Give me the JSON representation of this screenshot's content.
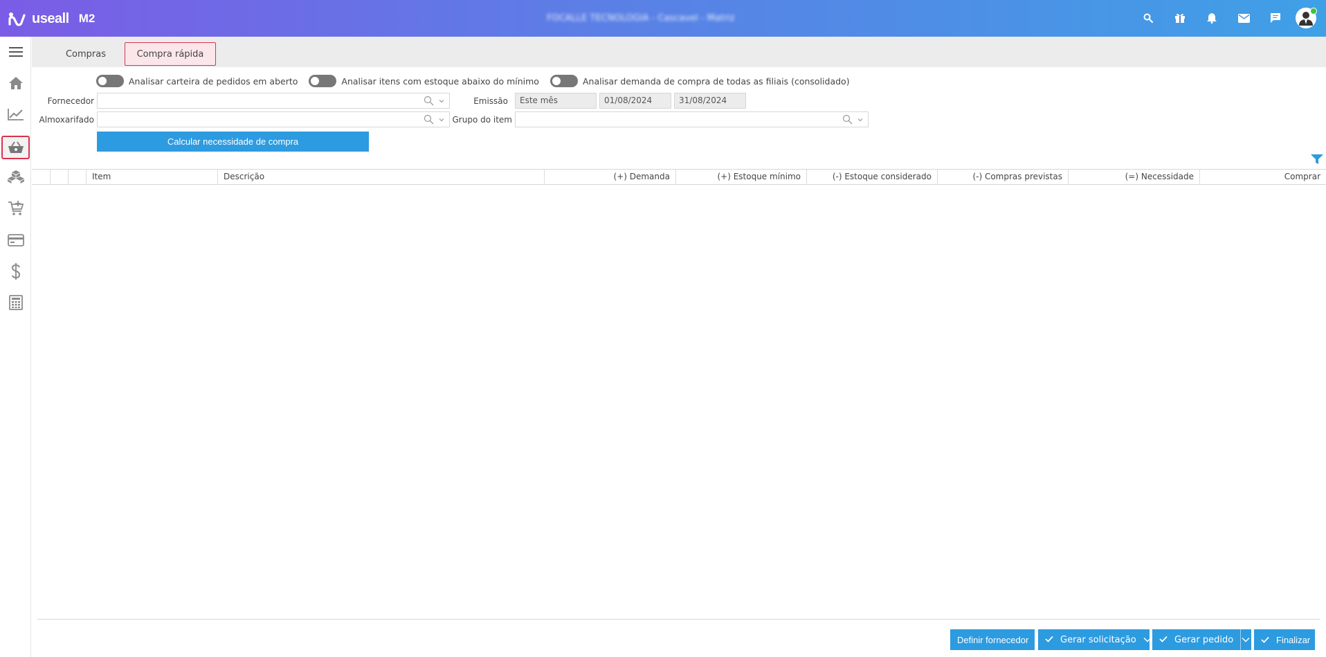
{
  "app": {
    "brand": "useall",
    "product": "M2",
    "company": "FOCALLE TECNOLOGIA - Cascavel - Matriz"
  },
  "colors": {
    "accent": "#2d9be0",
    "active_border": "#d9334f",
    "topbar_start": "#7b5ce6",
    "topbar_end": "#3fa0e6"
  },
  "topbar_icons": [
    "search-icon",
    "gift-icon",
    "bell-icon",
    "mail-icon",
    "chat-icon",
    "avatar"
  ],
  "sidebar": {
    "items": [
      {
        "icon": "menu-icon"
      },
      {
        "icon": "home-icon"
      },
      {
        "icon": "chart-icon"
      },
      {
        "icon": "basket-icon",
        "active": true
      },
      {
        "icon": "boxes-icon"
      },
      {
        "icon": "cart-add-icon"
      },
      {
        "icon": "card-icon"
      },
      {
        "icon": "dollar-icon"
      },
      {
        "icon": "calculator-icon"
      }
    ]
  },
  "tabs": [
    {
      "label": "Compras"
    },
    {
      "label": "Compra rápida",
      "active": true
    }
  ],
  "toggles": [
    {
      "label": "Analisar carteira de pedidos em aberto",
      "on": false
    },
    {
      "label": "Analisar itens com estoque abaixo do mínimo",
      "on": false
    },
    {
      "label": "Analisar demanda de compra de todas as filiais (consolidado)",
      "on": false
    }
  ],
  "form": {
    "fornecedor_label": "Fornecedor",
    "fornecedor_value": "",
    "almoxarifado_label": "Almoxarifado",
    "almoxarifado_value": "",
    "emissao_label": "Emissão",
    "emissao_period": "Este mês",
    "emissao_start": "01/08/2024",
    "emissao_end": "31/08/2024",
    "grupo_label": "Grupo do item",
    "grupo_value": "",
    "calc_button": "Calcular necessidade de compra"
  },
  "table": {
    "columns": [
      "Item",
      "Descrição",
      "(+) Demanda",
      "(+) Estoque mínimo",
      "(-) Estoque considerado",
      "(-) Compras previstas",
      "(=) Necessidade",
      "Comprar"
    ],
    "rows": []
  },
  "footer": {
    "definir_fornecedor": "Definir fornecedor",
    "gerar_solicitacao": "Gerar solicitação",
    "gerar_pedido": "Gerar pedido",
    "finalizar": "Finalizar"
  }
}
